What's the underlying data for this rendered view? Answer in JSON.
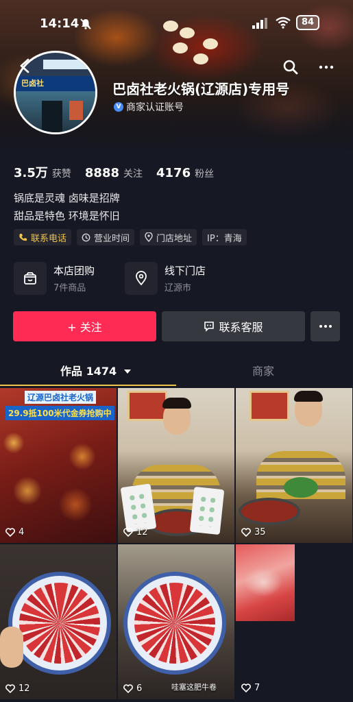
{
  "status_bar": {
    "time": "14:14",
    "battery": "84"
  },
  "profile": {
    "name": "巴卤社老火锅(辽源店)专用号",
    "verification": "商家认证账号",
    "stats": [
      {
        "value": "3.5万",
        "label": "获赞"
      },
      {
        "value": "8888",
        "label": "关注"
      },
      {
        "value": "4176",
        "label": "粉丝"
      }
    ],
    "bio_line1": "锅底是灵魂 卤味是招牌",
    "bio_line2": "甜品是特色 环境是怀旧",
    "tags": {
      "phone": "联系电话",
      "hours": "营业时间",
      "address": "门店地址",
      "ip": "IP：青海"
    },
    "services": {
      "group_buy_title": "本店团购",
      "group_buy_sub": "7件商品",
      "store_title": "线下门店",
      "store_sub": "辽源市"
    },
    "buttons": {
      "follow": "+ 关注",
      "contact": "联系客服"
    }
  },
  "avatar_sign": "巴卤社",
  "tabs": {
    "works": "作品 1474",
    "shop": "商家"
  },
  "videos": [
    {
      "likes": "4",
      "caption_top": "辽源巴卤社老火锅",
      "caption_sub": "29.9抵100米代金券抢购中"
    },
    {
      "likes": "12"
    },
    {
      "likes": "35"
    },
    {
      "likes": "12"
    },
    {
      "likes": "6",
      "caption": "哇塞这肥牛卷"
    },
    {
      "likes": "7"
    }
  ],
  "colors": {
    "follow": "#fe2c55",
    "accent": "#f1c54a",
    "background": "#161823"
  }
}
